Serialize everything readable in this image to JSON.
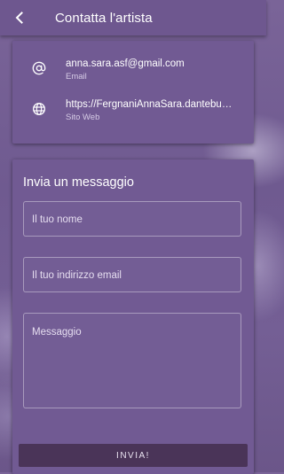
{
  "header": {
    "title": "Contatta l'artista",
    "back_icon": "arrow-back-icon"
  },
  "contact": {
    "email": {
      "value": "anna.sara.asf@gmail.com",
      "label": "Email",
      "icon": "at-sign-icon"
    },
    "website": {
      "value": "https://FergnaniAnnaSara.dantebus.com",
      "label": "Sito Web",
      "icon": "globe-icon"
    }
  },
  "message_form": {
    "title": "Invia un messaggio",
    "name_placeholder": "Il tuo nome",
    "email_placeholder": "Il tuo indirizzo email",
    "message_placeholder": "Messaggio",
    "submit_label": "INVIA!"
  },
  "colors": {
    "appbar": "#6e578f",
    "card": "#715a93",
    "button": "#4a3458"
  }
}
